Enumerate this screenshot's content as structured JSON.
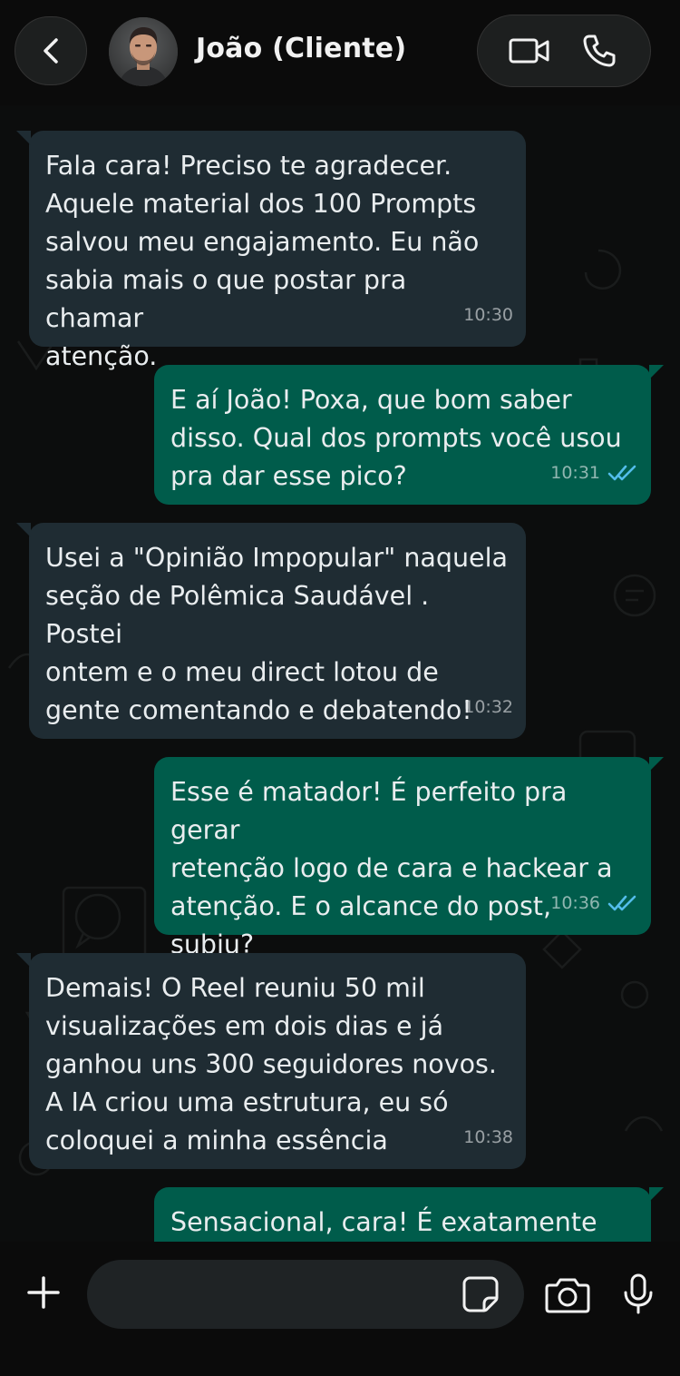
{
  "header": {
    "contact_name": "João (Cliente)",
    "icons": [
      "back-arrow-icon",
      "video-call-icon",
      "phone-call-icon"
    ]
  },
  "messages": [
    {
      "direction": "in",
      "text": "Fala cara! Preciso te agradecer.\nAquele material dos 100 Prompts\nsalvou meu engajamento. Eu não\nsabia mais o que postar pra chamar\natenção.",
      "time": "10:30"
    },
    {
      "direction": "out",
      "text": "E aí João! Poxa, que bom saber\ndisso. Qual dos prompts você usou\npra dar esse pico?",
      "time": "10:31",
      "status": "read"
    },
    {
      "direction": "in",
      "text": "Usei a \"Opinião Impopular\" naquela\nseção de Polêmica Saudável . Postei\nontem e o meu direct lotou de\ngente comentando e debatendo!",
      "time": "10:32"
    },
    {
      "direction": "out",
      "text": "Esse é matador! É perfeito pra gerar\nretenção logo de cara e hackear a\natenção. E o alcance do post, subiu?",
      "time": "10:36",
      "status": "read"
    },
    {
      "direction": "in",
      "text": "Demais! O Reel reuniu 50 mil\nvisualizações em dois dias e já\nganhou uns 300 seguidores novos.\nA IA criou uma estrutura, eu só\ncoloquei a minha essência",
      "time": "10:38"
    },
    {
      "direction": "out",
      "text": "Sensacional, cara! É exatamente essa",
      "time": "",
      "status": ""
    }
  ],
  "composer": {
    "placeholder": "",
    "icons": [
      "plus-icon",
      "sticker-icon",
      "camera-icon",
      "microphone-icon"
    ]
  },
  "colors": {
    "incoming_bubble": "#1f2c33",
    "outgoing_bubble": "#005c4b",
    "read_ticks": "#53bdeb",
    "background": "#0c0d0d"
  }
}
